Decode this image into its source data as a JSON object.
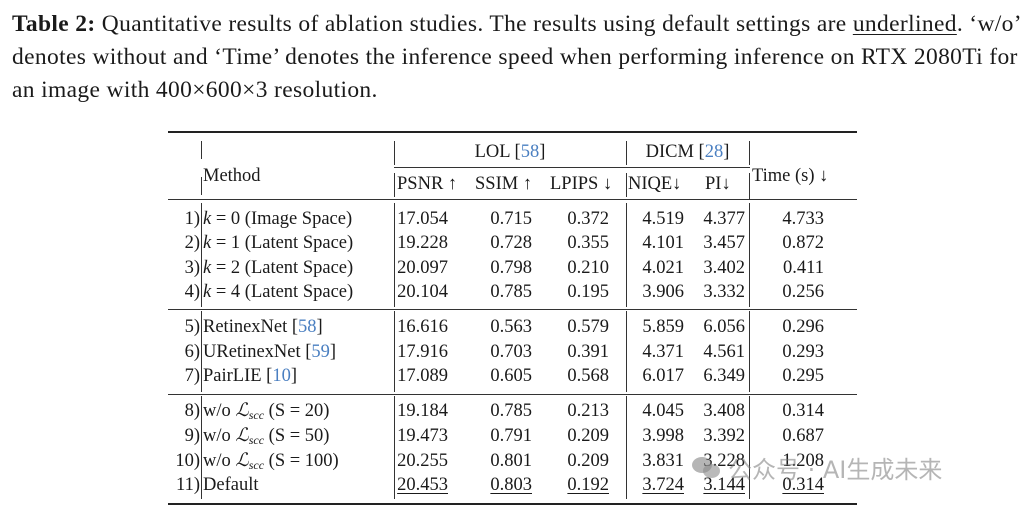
{
  "caption": {
    "label": "Table 2:",
    "part1": " Quantitative results of ablation studies. The results using default settings are ",
    "underlined_word": "underlined",
    "part2": ". ‘w/o’ denotes without and ‘Time’ denotes the inference speed when performing inference on RTX 2080Ti for an image with 400×600×3 resolution."
  },
  "header": {
    "method": "Method",
    "lol": "LOL [",
    "lol_cite": "58",
    "lol_close": "]",
    "dicm": "DICM [",
    "dicm_cite": "28",
    "dicm_close": "]",
    "psnr": "PSNR ↑",
    "ssim": "SSIM ↑",
    "lpips": "LPIPS ↓",
    "niqe": "NIQE↓",
    "pi": "PI↓",
    "time": "Time (s) ↓"
  },
  "rows": [
    {
      "idx": "1)",
      "m_pre": "",
      "m_var": "k",
      "m_post": " = 0 (Image Space)",
      "cite": "",
      "psnr": "17.054",
      "ssim": "0.715",
      "lpips": "0.372",
      "niqe": "4.519",
      "pi": "4.377",
      "time": "4.733"
    },
    {
      "idx": "2)",
      "m_pre": "",
      "m_var": "k",
      "m_post": " = 1 (Latent Space)",
      "cite": "",
      "psnr": "19.228",
      "ssim": "0.728",
      "lpips": "0.355",
      "niqe": "4.101",
      "pi": "3.457",
      "time": "0.872"
    },
    {
      "idx": "3)",
      "m_pre": "",
      "m_var": "k",
      "m_post": " = 2 (Latent Space)",
      "cite": "",
      "psnr": "20.097",
      "ssim": "0.798",
      "lpips": "0.210",
      "niqe": "4.021",
      "pi": "3.402",
      "time": "0.411"
    },
    {
      "idx": "4)",
      "m_pre": "",
      "m_var": "k",
      "m_post": " = 4 (Latent Space)",
      "cite": "",
      "psnr": "20.104",
      "ssim": "0.785",
      "lpips": "0.195",
      "niqe": "3.906",
      "pi": "3.332",
      "time": "0.256"
    },
    {
      "idx": "5)",
      "m_pre": "RetinexNet [",
      "m_var": "",
      "m_post": "",
      "cite": "58",
      "psnr": "16.616",
      "ssim": "0.563",
      "lpips": "0.579",
      "niqe": "5.859",
      "pi": "6.056",
      "time": "0.296"
    },
    {
      "idx": "6)",
      "m_pre": "URetinexNet [",
      "m_var": "",
      "m_post": "",
      "cite": "59",
      "psnr": "17.916",
      "ssim": "0.703",
      "lpips": "0.391",
      "niqe": "4.371",
      "pi": "4.561",
      "time": "0.293"
    },
    {
      "idx": "7)",
      "m_pre": "PairLIE [",
      "m_var": "",
      "m_post": "",
      "cite": "10",
      "psnr": "17.089",
      "ssim": "0.605",
      "lpips": "0.568",
      "niqe": "6.017",
      "pi": "6.349",
      "time": "0.295"
    },
    {
      "idx": "8)",
      "m_pre": "w/o ",
      "m_var": "ℒ",
      "m_post": "scc|(S = 20)",
      "cite": "",
      "psnr": "19.184",
      "ssim": "0.785",
      "lpips": "0.213",
      "niqe": "4.045",
      "pi": "3.408",
      "time": "0.314"
    },
    {
      "idx": "9)",
      "m_pre": "w/o ",
      "m_var": "ℒ",
      "m_post": "scc|(S = 50)",
      "cite": "",
      "psnr": "19.473",
      "ssim": "0.791",
      "lpips": "0.209",
      "niqe": "3.998",
      "pi": "3.392",
      "time": "0.687"
    },
    {
      "idx": "10)",
      "m_pre": "w/o ",
      "m_var": "ℒ",
      "m_post": "scc|(S = 100)",
      "cite": "",
      "psnr": "20.255",
      "ssim": "0.801",
      "lpips": "0.209",
      "niqe": "3.831",
      "pi": "3.228",
      "time": "1.208"
    },
    {
      "idx": "11)",
      "m_pre": "Default",
      "m_var": "",
      "m_post": "",
      "cite": "",
      "psnr": "20.453",
      "ssim": "0.803",
      "lpips": "0.192",
      "niqe": "3.724",
      "pi": "3.144",
      "time": "0.314",
      "underlined": true
    }
  ],
  "watermark": {
    "text": "公众号 · AI生成未来",
    "icon": "wechat-icon"
  },
  "colors": {
    "citation": "#4a7fc1",
    "text": "#1a1a1a"
  }
}
